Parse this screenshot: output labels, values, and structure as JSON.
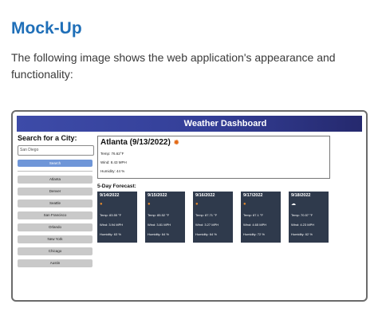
{
  "doc": {
    "title": "Mock-Up",
    "paragraph": "The following image shows the web application's appearance and functionality:"
  },
  "app": {
    "header_title": "Weather Dashboard",
    "sidebar": {
      "title": "Search for a City:",
      "search_value": "San Diego",
      "search_button": "Search",
      "history": [
        "Atlanta",
        "Denver",
        "Seattle",
        "San Francisco",
        "Orlando",
        "New York",
        "Chicago",
        "Austin"
      ]
    },
    "current": {
      "title": "Atlanta (9/13/2022)",
      "icon": "sun-icon",
      "temp": "Temp: 76.62°F",
      "wind": "Wind: 8.43 MPH",
      "humidity": "Humidity: 44 %"
    },
    "forecast_title": "5-Day Forecast:",
    "forecast": [
      {
        "date": "9/14/2022",
        "icon": "sun-icon",
        "temp": "Temp: 83.55 °F",
        "wind": "Wind: 3.94 MPH",
        "humidity": "Humidity: 63 %"
      },
      {
        "date": "9/15/2022",
        "icon": "sun-icon",
        "temp": "Temp: 85.52 °F",
        "wind": "Wind: 3.81 MPH",
        "humidity": "Humidity: 64 %"
      },
      {
        "date": "9/16/2022",
        "icon": "sun-icon",
        "temp": "Temp: 87.71 °F",
        "wind": "Wind: 3.27 MPH",
        "humidity": "Humidity: 64 %"
      },
      {
        "date": "9/17/2022",
        "icon": "sun-icon",
        "temp": "Temp: 87.1 °F",
        "wind": "Wind: 4.65 MPH",
        "humidity": "Humidity: 72 %"
      },
      {
        "date": "9/18/2022",
        "icon": "cloud-icon",
        "temp": "Temp: 70.57 °F",
        "wind": "Wind: 4.23 MPH",
        "humidity": "Humidity: 62 %"
      }
    ],
    "colors": {
      "header": "#343f98",
      "card": "#2f3a4c",
      "search_button": "#6f96d8",
      "history_button": "#c9c9c9",
      "doc_title": "#1f6fb8"
    }
  }
}
